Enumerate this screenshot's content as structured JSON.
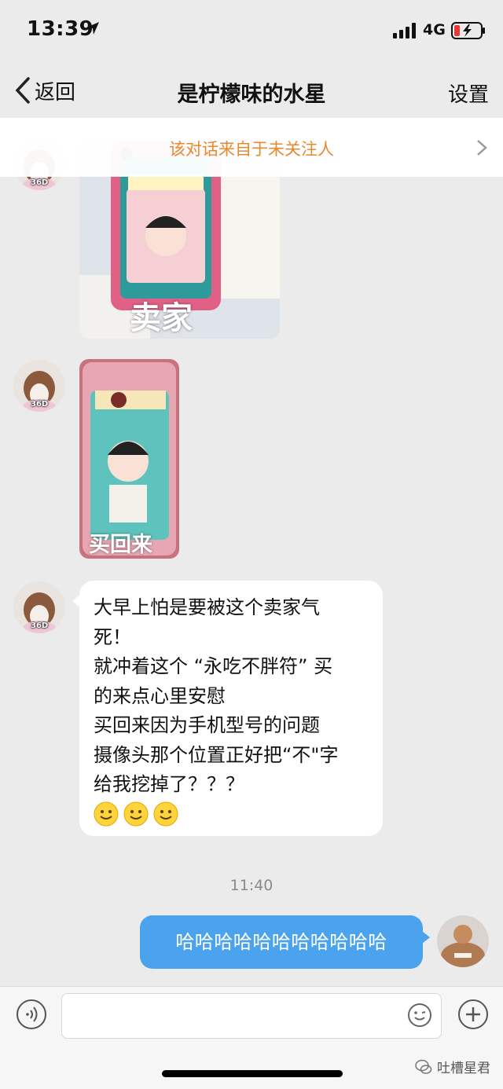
{
  "status_bar": {
    "time": "13:39",
    "network": "4G"
  },
  "nav": {
    "back_label": "返回",
    "title": "是柠檬味的水星",
    "settings_label": "设置"
  },
  "banner": {
    "text": "该对话来自于未关注人"
  },
  "avatar_badge": "36D",
  "messages": {
    "photo1_caption": "卖家",
    "photo2_caption": "买回来",
    "text_lines": [
      "大早上怕是要被这个卖家气",
      "死！",
      "就冲着这个 “永吃不胖符” 买",
      "的来点心里安慰",
      "买回来因为手机型号的问题",
      "摄像头那个位置正好把“不\"字",
      "给我挖掉了？？？"
    ],
    "timestamp": "11:40",
    "outgoing": "哈哈哈哈哈哈哈哈哈哈哈"
  },
  "watermark": "吐槽星君",
  "colors": {
    "accent_blue": "#4aa3ec",
    "banner_orange": "#e8892f",
    "background": "#ebebeb"
  }
}
